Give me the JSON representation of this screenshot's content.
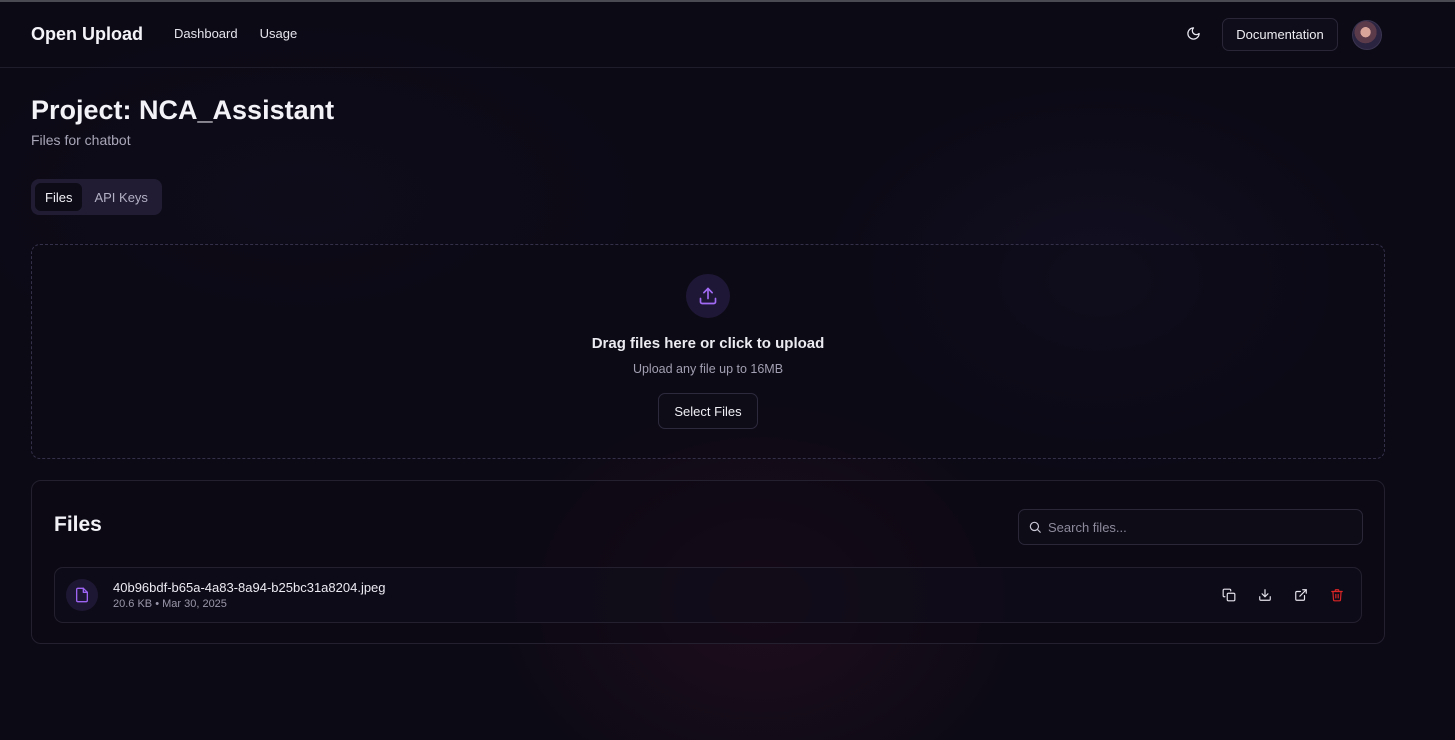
{
  "header": {
    "brand": "Open Upload",
    "nav": [
      {
        "label": "Dashboard"
      },
      {
        "label": "Usage"
      }
    ],
    "documentation_label": "Documentation",
    "theme_icon": "moon-icon"
  },
  "project": {
    "title": "Project: NCA_Assistant",
    "subtitle": "Files for chatbot"
  },
  "tabs": [
    {
      "label": "Files",
      "active": true
    },
    {
      "label": "API Keys",
      "active": false
    }
  ],
  "upload": {
    "icon": "upload-icon",
    "title": "Drag files here or click to upload",
    "subtitle": "Upload any file up to 16MB",
    "button_label": "Select Files"
  },
  "files": {
    "title": "Files",
    "search_placeholder": "Search files...",
    "items": [
      {
        "name": "40b96bdf-b65a-4a83-8a94-b25bc31a8204.jpeg",
        "meta": "20.6 KB • Mar 30, 2025",
        "actions": [
          "copy-icon",
          "download-icon",
          "external-link-icon",
          "trash-icon"
        ]
      }
    ]
  },
  "colors": {
    "background": "#0c0a15",
    "accent": "#8b5cf6",
    "danger": "#dc2626",
    "border": "#24202f"
  }
}
